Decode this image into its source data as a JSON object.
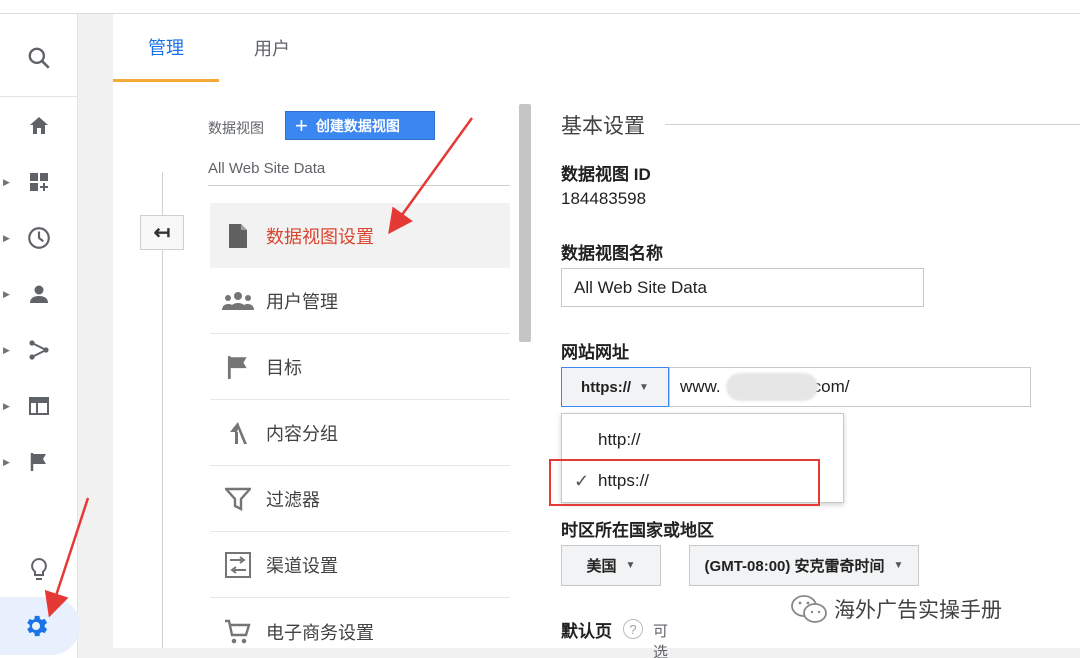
{
  "tabs": {
    "admin": "管理",
    "users": "用户"
  },
  "rail": {
    "search_icon": "search-icon",
    "items": [
      "home-icon",
      "customization-icon",
      "realtime-icon",
      "audience-icon",
      "acquisition-icon",
      "behavior-icon",
      "conversions-icon"
    ],
    "discover_icon": "lightbulb-icon",
    "admin_icon": "gear-icon"
  },
  "view_column": {
    "label": "数据视图",
    "create_button": "创建数据视图",
    "current_view": "All Web Site Data",
    "menu": [
      {
        "label": "数据视图设置",
        "icon": "document-icon",
        "selected": true
      },
      {
        "label": "用户管理",
        "icon": "people-icon"
      },
      {
        "label": "目标",
        "icon": "flag-icon"
      },
      {
        "label": "内容分组",
        "icon": "content-grouping-icon"
      },
      {
        "label": "过滤器",
        "icon": "filter-icon"
      },
      {
        "label": "渠道设置",
        "icon": "channel-settings-icon"
      },
      {
        "label": "电子商务设置",
        "icon": "cart-icon"
      }
    ]
  },
  "settings": {
    "section_title": "基本设置",
    "view_id_label": "数据视图 ID",
    "view_id_value": "184483598",
    "view_name_label": "数据视图名称",
    "view_name_value": "All Web Site Data",
    "website_url_label": "网站网址",
    "protocol_selected": "https://",
    "url_value_prefix": "www.",
    "url_value_suffix": "com/",
    "protocol_options": [
      "http://",
      "https://"
    ],
    "timezone_label": "时区所在国家或地区",
    "country": "美国",
    "timezone": "(GMT-08:00) 安克雷奇时间",
    "default_page_label": "默认页",
    "default_page_optional": "可选"
  },
  "watermark": "海外广告实操手册",
  "colors": {
    "accent_blue": "#1a73e8",
    "button_blue": "#3b87f2",
    "highlight_red": "#e53935",
    "tab_underline": "#f4a938"
  }
}
